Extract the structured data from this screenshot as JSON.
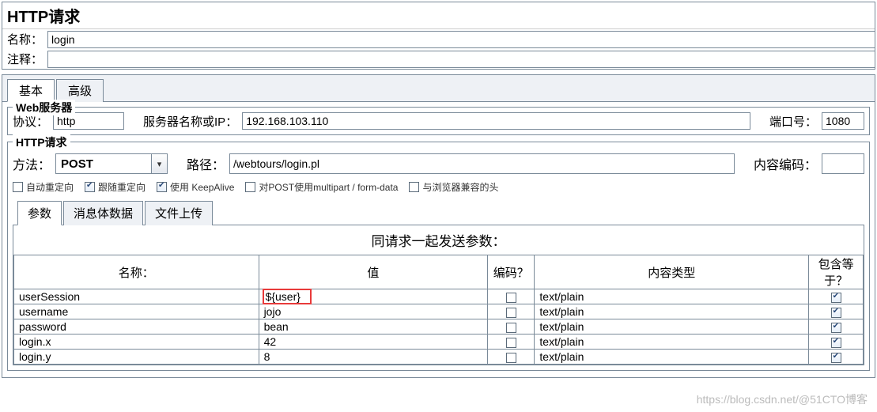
{
  "panel_title": "HTTP请求",
  "name_label": "名称：",
  "name_value": "login",
  "comment_label": "注释：",
  "comment_value": "",
  "tabs": {
    "basic": "基本",
    "advanced": "高级"
  },
  "webserver": {
    "legend": "Web服务器",
    "protocol_label": "协议：",
    "protocol_value": "http",
    "server_label": "服务器名称或IP：",
    "server_value": "192.168.103.110",
    "port_label": "端口号：",
    "port_value": "1080"
  },
  "http": {
    "legend": "HTTP请求",
    "method_label": "方法：",
    "method_value": "POST",
    "path_label": "路径：",
    "path_value": "/webtours/login.pl",
    "encoding_label": "内容编码：",
    "encoding_value": ""
  },
  "checks": {
    "auto_redirect": "自动重定向",
    "follow_redirect": "跟随重定向",
    "keepalive": "使用 KeepAlive",
    "multipart": "对POST使用multipart / form-data",
    "browser_compat": "与浏览器兼容的头"
  },
  "inner_tabs": {
    "params": "参数",
    "body": "消息体数据",
    "upload": "文件上传"
  },
  "params_title": "同请求一起发送参数：",
  "param_cols": {
    "name": "名称：",
    "value": "值",
    "encode": "编码？",
    "type": "内容类型",
    "eq": "包含等于？"
  },
  "params": [
    {
      "name": "userSession",
      "value": "${user}",
      "highlight": true,
      "type": "text/plain"
    },
    {
      "name": "username",
      "value": "jojo",
      "type": "text/plain"
    },
    {
      "name": "password",
      "value": "bean",
      "type": "text/plain"
    },
    {
      "name": "login.x",
      "value": "42",
      "type": "text/plain"
    },
    {
      "name": "login.y",
      "value": "8",
      "type": "text/plain"
    }
  ],
  "watermark": "https://blog.csdn.net/@51CTO博客"
}
